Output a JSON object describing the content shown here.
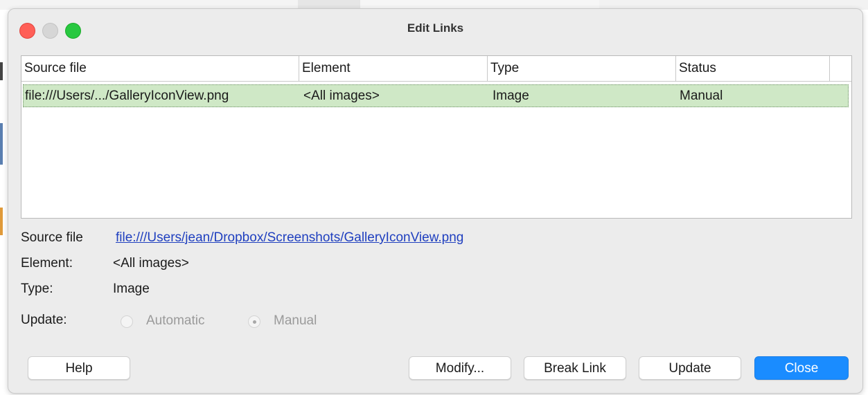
{
  "dialog": {
    "title": "Edit Links"
  },
  "table": {
    "columns": [
      "Source file",
      "Element",
      "Type",
      "Status"
    ],
    "rows": [
      {
        "source_file": "file:///Users/.../GalleryIconView.png",
        "element": "<All images>",
        "type": "Image",
        "status": "Manual"
      }
    ]
  },
  "details": {
    "source_file_label": "Source file",
    "source_file_value": "file:///Users/jean/Dropbox/Screenshots/GalleryIconView.png",
    "element_label": "Element:",
    "element_value": "<All images>",
    "type_label": "Type:",
    "type_value": "Image",
    "update_label": "Update:",
    "update_options": [
      "Automatic",
      "Manual"
    ],
    "update_selected": "Manual"
  },
  "buttons": {
    "help": "Help",
    "modify": "Modify...",
    "break_link": "Break Link",
    "update": "Update",
    "close": "Close"
  },
  "colors": {
    "selected_row": "#cfe8c6",
    "link": "#1f3fbf",
    "primary_button": "#1a8cff",
    "traffic_close": "#ff5f57",
    "traffic_max": "#28c840"
  }
}
